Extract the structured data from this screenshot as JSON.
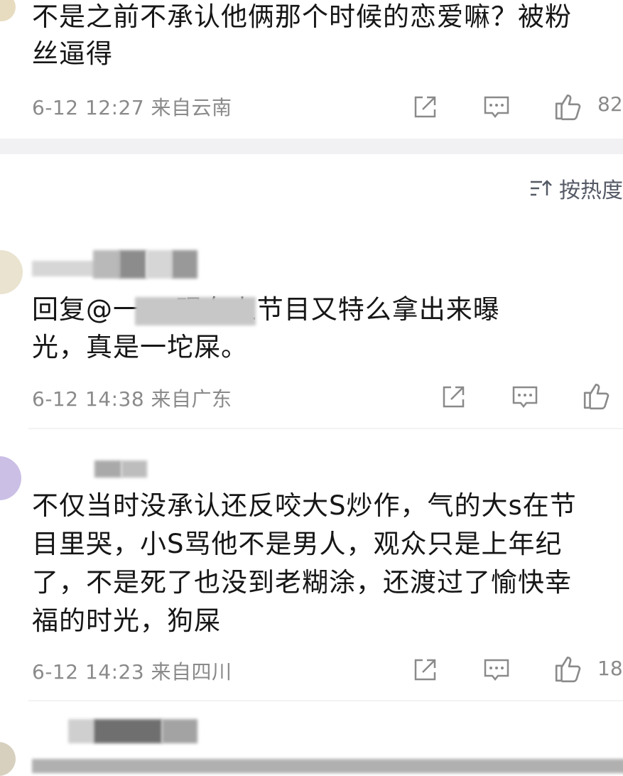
{
  "comments": [
    {
      "text_lines": [
        "不是之前不承认他俩那个时候的恋爱嘛？被粉",
        "丝逼得"
      ],
      "meta": "6-12 12:27 来自云南",
      "likes": "82"
    },
    {
      "text_lines": [
        "回复@一                 ：现在上节目又特么拿出来曝",
        "光，真是一坨屎。"
      ],
      "meta": "6-12 14:38 来自广东",
      "likes": ""
    },
    {
      "text_lines": [
        "不仅当时没承认还反咬大S炒作，气的大s在节",
        "目里哭，小S骂他不是男人，观众只是上年纪",
        "了，不是死了也没到老糊涂，还渡过了愉快幸",
        "福的时光，狗屎"
      ],
      "meta": "6-12 14:23 来自四川",
      "likes": "18"
    }
  ],
  "sort": {
    "label": "按热度",
    "icon": "sort-icon"
  },
  "icons": {
    "share": "share-icon",
    "comment": "comment-icon",
    "like": "thumbs-up-icon"
  }
}
